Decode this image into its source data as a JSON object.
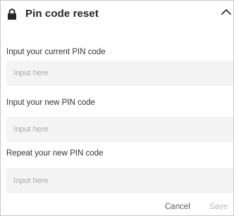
{
  "header": {
    "title": "Pin code reset",
    "icon": "lock-icon",
    "collapse_icon": "chevron-up-icon"
  },
  "fields": [
    {
      "label": "Input your current PIN code",
      "value": "",
      "placeholder": "Input here"
    },
    {
      "label": "Input your new PIN code",
      "value": "",
      "placeholder": "Input here"
    },
    {
      "label": "Repeat your new PIN code",
      "value": "",
      "placeholder": "Input here"
    }
  ],
  "footer": {
    "cancel_label": "Cancel",
    "save_label": "Save"
  },
  "colors": {
    "input_background": "#f4f4f4",
    "save_disabled": "#b8b8b8"
  }
}
